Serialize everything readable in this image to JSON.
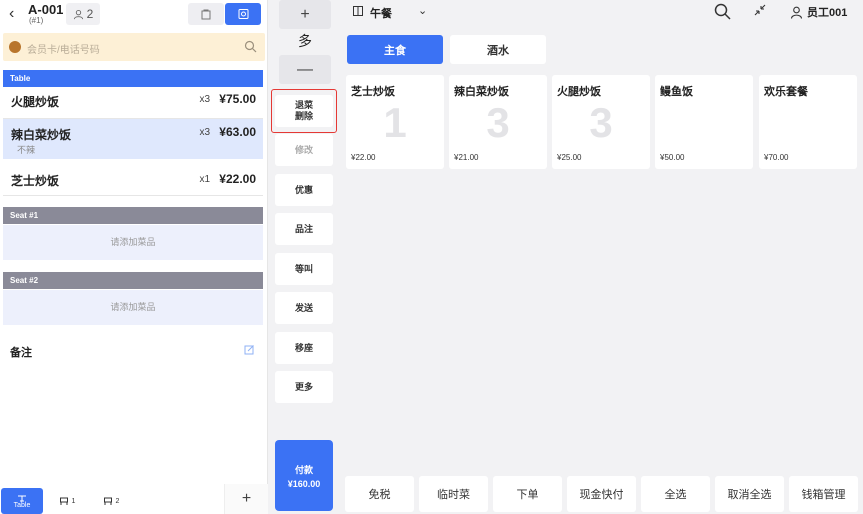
{
  "order": {
    "number": "A-001",
    "sub": "(#1)",
    "guests": "2"
  },
  "member": {
    "placeholder": "会员卡/电话号码"
  },
  "sections": {
    "table": "Table",
    "seat1": "Seat #1",
    "seat2": "Seat #2"
  },
  "items": [
    {
      "name": "火腿炒饭",
      "qty": "x3",
      "price": "¥75.00",
      "note": ""
    },
    {
      "name": "辣白菜炒饭",
      "qty": "x3",
      "price": "¥63.00",
      "note": "不辣"
    },
    {
      "name": "芝士炒饭",
      "qty": "x1",
      "price": "¥22.00",
      "note": ""
    }
  ],
  "empty_hint": "请添加菜品",
  "remark_label": "备注",
  "bottom_tabs": {
    "table": "Table",
    "seat1": "1",
    "seat2": "2",
    "add": "+"
  },
  "qty_panel": {
    "plus": "+",
    "value": "多",
    "minus": "—"
  },
  "actions": {
    "return_line1": "退菜",
    "return_line2": "删除",
    "modify": "修改",
    "discount": "优惠",
    "item_note": "品注",
    "hold": "等叫",
    "send": "发送",
    "move_seat": "移座",
    "more": "更多"
  },
  "pay": {
    "label": "付款",
    "amount": "¥160.00"
  },
  "header": {
    "meal": "午餐",
    "user": "员工001"
  },
  "categories": [
    "主食",
    "酒水"
  ],
  "products": [
    {
      "name": "芝士炒饭",
      "count": "1",
      "price": "¥22.00"
    },
    {
      "name": "辣白菜炒饭",
      "count": "3",
      "price": "¥21.00"
    },
    {
      "name": "火腿炒饭",
      "count": "3",
      "price": "¥25.00"
    },
    {
      "name": "鳗鱼饭",
      "count": "",
      "price": "¥50.00"
    },
    {
      "name": "欢乐套餐",
      "count": "",
      "price": "¥70.00"
    }
  ],
  "bottom_actions": [
    "免税",
    "临时菜",
    "下单",
    "现金快付",
    "全选",
    "取消全选",
    "钱箱管理"
  ],
  "colors": {
    "accent": "#3b72f4",
    "highlight": "#e53935",
    "member_bg": "#fdf0d6"
  }
}
